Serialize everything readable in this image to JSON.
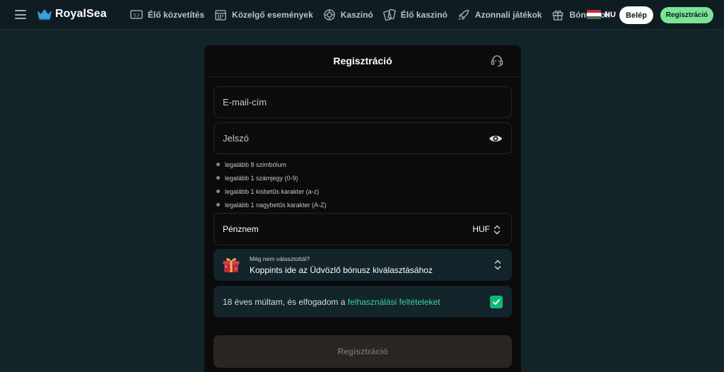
{
  "nav": {
    "brand": "RoyalSea",
    "items": [
      {
        "label": "Élő közvetítés",
        "icon": "live-tv-icon"
      },
      {
        "label": "Közelgő események",
        "icon": "calendar-icon"
      },
      {
        "label": "Kaszinó",
        "icon": "casino-chip-icon"
      },
      {
        "label": "Élő kaszinó",
        "icon": "cards-icon"
      },
      {
        "label": "Azonnali játékok",
        "icon": "rocket-icon"
      },
      {
        "label": "Bónuszok",
        "icon": "gift-icon"
      }
    ],
    "language": "HU",
    "login_label": "Belép",
    "register_label": "Regisztráció"
  },
  "form": {
    "title": "Regisztráció",
    "email_placeholder": "E-mail-cím",
    "password_placeholder": "Jelszó",
    "password_rules": [
      "legalább 8 szimbólum",
      "legalább 1 számjegy (0-9)",
      "legalább 1 kisbetűs karakter (a-z)",
      "legalább 1 nagybetűs karakter (A-Z)"
    ],
    "currency_label": "Pénznem",
    "currency_value": "HUF",
    "bonus_hint": "Még nem választottál?",
    "bonus_cta": "Koppints ide az Üdvözlő bónusz kiválasztásához",
    "terms_text": "18 éves múltam, és elfogadom a",
    "terms_link": "felhasználási feltételeket",
    "terms_checked": true,
    "submit_label": "Regisztráció"
  },
  "colors": {
    "background": "#132429",
    "accent_green": "#7be495",
    "link_green": "#3cd29a",
    "checkbox_green": "#11b77a"
  }
}
